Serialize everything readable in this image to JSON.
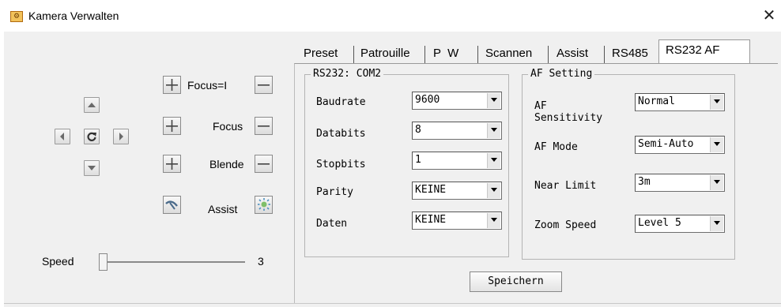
{
  "window": {
    "title": "Kamera Verwalten",
    "close_glyph": "✕",
    "icon": "camera-app-icon"
  },
  "ptz": {
    "focus_near_label": "Focus=I",
    "focus_label": "Focus",
    "iris_label": "Blende",
    "assist_label": "Assist",
    "speed_label": "Speed",
    "speed_value": "3"
  },
  "tabs": [
    {
      "label": "Preset",
      "active": false
    },
    {
      "label": "Patrouille",
      "active": false
    },
    {
      "label": "P  W",
      "active": false
    },
    {
      "label": "Scannen",
      "active": false
    },
    {
      "label": "Assist",
      "active": false
    },
    {
      "label": "RS485",
      "active": false
    },
    {
      "label": "RS232 AF",
      "active": true
    }
  ],
  "rs232": {
    "title": "RS232: COM2",
    "rows": [
      {
        "label": "Baudrate",
        "value": "9600"
      },
      {
        "label": "Databits",
        "value": "8"
      },
      {
        "label": "Stopbits",
        "value": "1"
      },
      {
        "label": "Parity",
        "value": "KEINE"
      },
      {
        "label": "Daten",
        "value": "KEINE"
      }
    ]
  },
  "af": {
    "title": "AF Setting",
    "rows": [
      {
        "label": "AF\nSensitivity",
        "value": "Normal"
      },
      {
        "label": "AF Mode",
        "value": "Semi-Auto"
      },
      {
        "label": "Near Limit",
        "value": "3m"
      },
      {
        "label": "Zoom Speed",
        "value": "Level 5"
      }
    ]
  },
  "save_label": "Speichern",
  "colors": {
    "accent_active_tab": "#ffffff",
    "panel_bg": "#f0f0f0",
    "button_icon": "#6a6a6a"
  }
}
